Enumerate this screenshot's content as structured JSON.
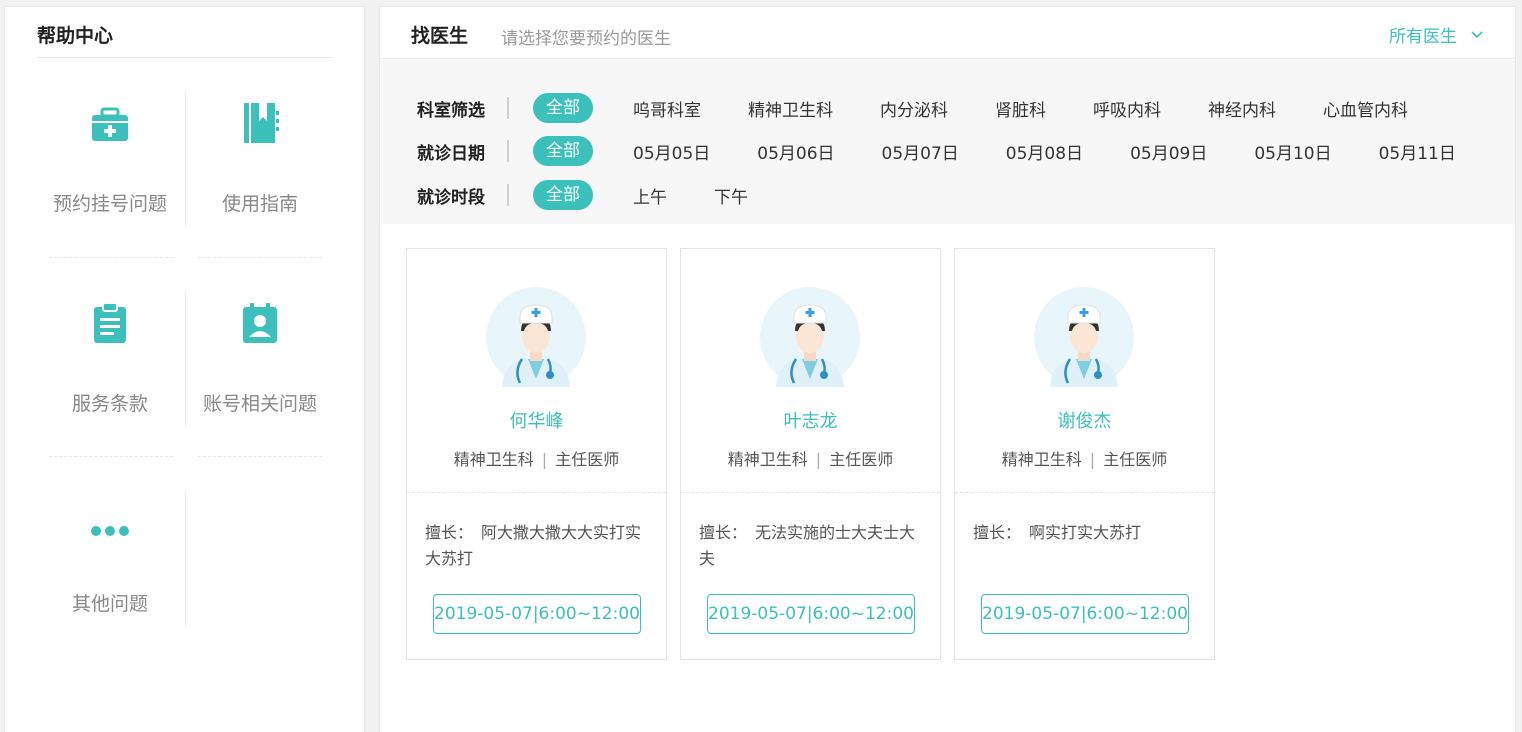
{
  "help": {
    "title": "帮助中心",
    "items": [
      {
        "label": "预约挂号问题",
        "icon": "medical-kit-icon"
      },
      {
        "label": "使用指南",
        "icon": "guide-book-icon"
      },
      {
        "label": "服务条款",
        "icon": "clipboard-icon"
      },
      {
        "label": "账号相关问题",
        "icon": "account-card-icon"
      },
      {
        "label": "其他问题",
        "icon": "more-dots-icon"
      }
    ]
  },
  "main": {
    "title": "找医生",
    "subtitle": "请选择您要预约的医生",
    "doctor_select": "所有医生"
  },
  "filters": {
    "department": {
      "label": "科室筛选",
      "options": [
        "全部",
        "呜哥科室",
        "精神卫生科",
        "内分泌科",
        "肾脏科",
        "呼吸内科",
        "神经内科",
        "心血管内科"
      ]
    },
    "date": {
      "label": "就诊日期",
      "options": [
        "全部",
        "05月05日",
        "05月06日",
        "05月07日",
        "05月08日",
        "05月09日",
        "05月10日",
        "05月11日"
      ]
    },
    "period": {
      "label": "就诊时段",
      "options": [
        "全部",
        "上午",
        "下午"
      ]
    }
  },
  "doctors": [
    {
      "name": "何华峰",
      "department": "精神卫生科",
      "title": "主任医师",
      "skill_label": "擅长：",
      "skill": "阿大撒大撒大大实打实大苏打",
      "slot": "2019-05-07|6:00~12:00"
    },
    {
      "name": "叶志龙",
      "department": "精神卫生科",
      "title": "主任医师",
      "skill_label": "擅长：",
      "skill": "无法实施的士大夫士大夫",
      "slot": "2019-05-07|6:00~12:00"
    },
    {
      "name": "谢俊杰",
      "department": "精神卫生科",
      "title": "主任医师",
      "skill_label": "擅长：",
      "skill": "啊实打实大苏打",
      "slot": "2019-05-07|6:00~12:00"
    }
  ],
  "colors": {
    "accent": "#3cc0bb",
    "avatar_bg": "#e8f5fb"
  },
  "separator": "|"
}
